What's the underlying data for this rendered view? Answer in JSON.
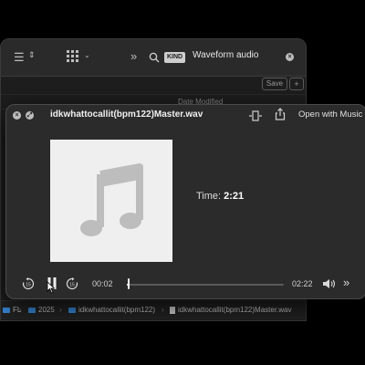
{
  "finder": {
    "search_kind": "KIND",
    "search_query": "Waveform audio",
    "save_label": "Save",
    "add_label": "+",
    "column_date_modified": "Date Modified",
    "path": [
      "FL",
      "2025",
      "idkwhattocallit(bpm122)",
      "idkwhattocallit(bpm122)Master.wav"
    ],
    "path_separator": "›"
  },
  "quicklook": {
    "file_name": "idkwhattocallit(bpm122)Master.wav",
    "open_with_label": "Open with Music",
    "time_caption": "Time:",
    "duration_display": "2:21",
    "elapsed": "00:02",
    "remaining": "02:22",
    "skip_back_seconds": "15",
    "skip_forward_seconds": "15",
    "progress_fraction": 0.014
  },
  "icons": {
    "close": "close-icon",
    "fullscreen": "fullscreen-icon",
    "share": "share-icon",
    "volume": "volume-icon",
    "more": "chevron-double-right-icon",
    "music_note": "music-note-icon"
  },
  "colors": {
    "folder": "#3b8de0",
    "background": "#2b2b2b"
  }
}
